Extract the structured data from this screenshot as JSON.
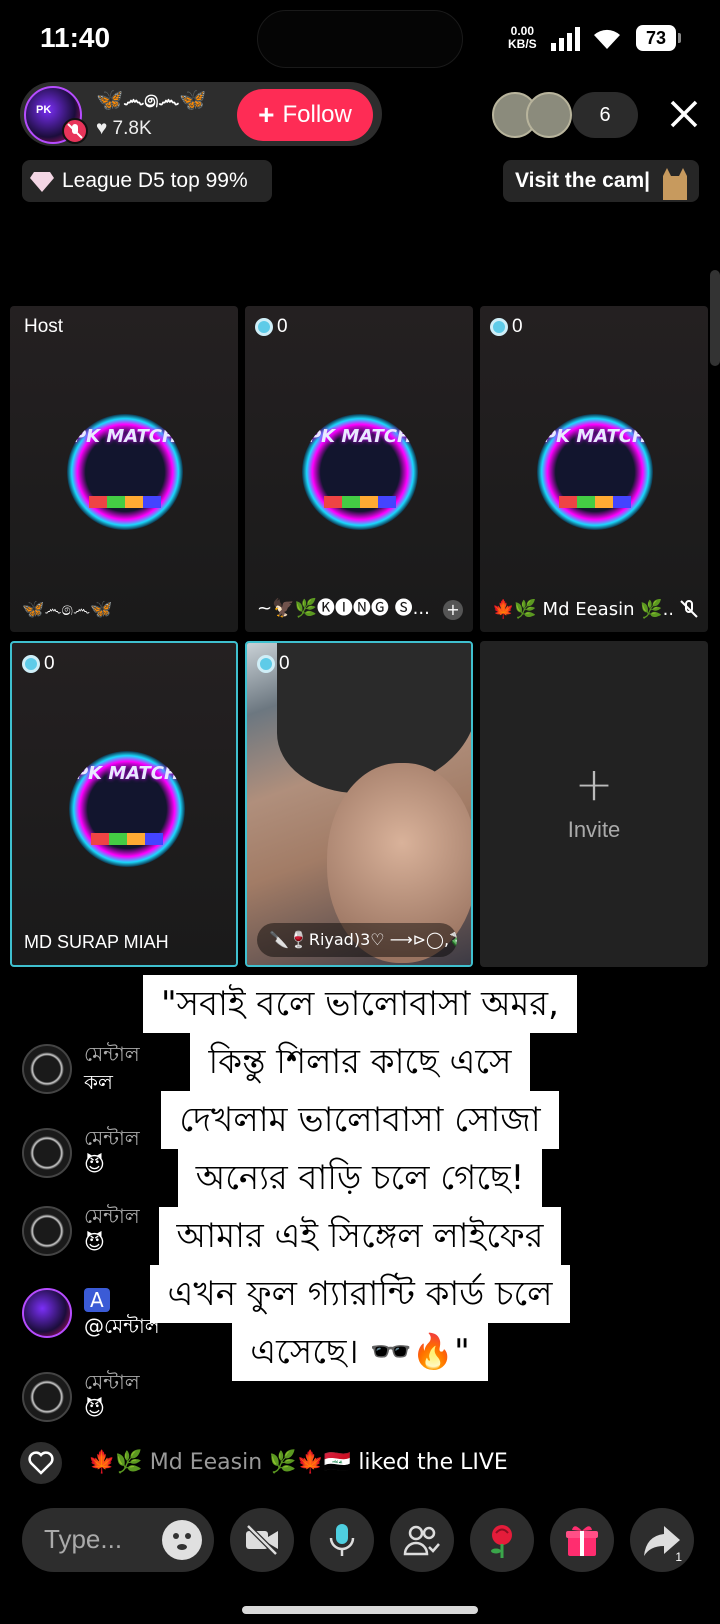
{
  "status": {
    "time": "11:40",
    "net_speed_value": "0.00",
    "net_speed_unit": "KB/S",
    "battery": "73"
  },
  "host": {
    "name": "🦋෴෧෴🦋",
    "likes": "♥ 7.8K",
    "follow_label": "Follow"
  },
  "viewers": {
    "count": "6"
  },
  "league": {
    "label": "League D5 top 99%"
  },
  "campaign": {
    "label": "Visit the cam|"
  },
  "seats": [
    {
      "tag": "Host",
      "name": "🦋෴෧෴🦋"
    },
    {
      "score": "0",
      "name": "~🦅🌿🅚🅘🅝🅖 🅢..."
    },
    {
      "score": "0",
      "name": "🍁🌿 Md Eeasin 🌿..."
    },
    {
      "score": "0",
      "name": "MD SURAP MIAH"
    },
    {
      "score": "0",
      "name": "🔪🍷Riyad)3♡ ⟶⊳◯,💸"
    },
    {
      "invite_label": "Invite"
    }
  ],
  "chat": [
    {
      "name": "মেন্টাল",
      "message": "কল"
    },
    {
      "name": "মেন্টাল",
      "message": "😈"
    },
    {
      "name": "মেন্টাল",
      "message": "😈"
    },
    {
      "name": "A",
      "message": "@মেন্টাল"
    },
    {
      "name": "মেন্টাল",
      "message": "😈"
    }
  ],
  "caption_lines": [
    "\"সবাই বলে ভালোবাসা অমর,",
    "কিন্তু শিলার কাছে এসে",
    "দেখলাম ভালোবাসা সোজা",
    "অন্যের বাড়ি চলে গেছে!",
    "আমার এই সিঙ্গেল লাইফের",
    "এখন ফুল গ্যারান্টি কার্ড চলে",
    "এসেছে। 🕶️🔥\""
  ],
  "liked": {
    "user": "🍁🌿 Md Eeasin 🌿🍁🇮🇶",
    "suffix": " liked the LIVE"
  },
  "input": {
    "placeholder": "Type..."
  },
  "share": {
    "count": "1"
  },
  "colors": {
    "follow": "#fe2c55",
    "highlight_border": "#3fc0cf",
    "background": "#000000"
  }
}
